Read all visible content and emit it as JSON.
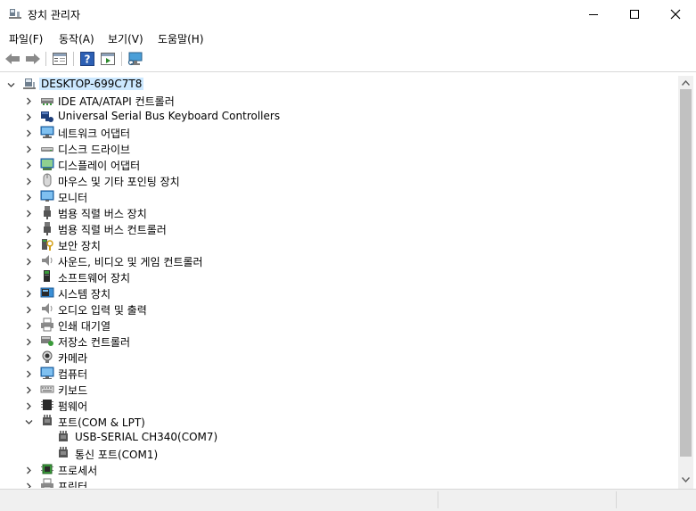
{
  "window": {
    "title": "장치 관리자"
  },
  "menu": [
    "파일(F)",
    "동작(A)",
    "보기(V)",
    "도움말(H)"
  ],
  "toolbar": [
    "back-icon",
    "forward-icon",
    "properties-icon",
    "help-icon",
    "update-driver-icon",
    "scan-hardware-icon"
  ],
  "tree": {
    "root": "DESKTOP-699C7T8",
    "categories": [
      {
        "label": "IDE ATA/ATAPI 컨트롤러",
        "icon": "ide-controller-icon",
        "expanded": false
      },
      {
        "label": "Universal Serial Bus Keyboard Controllers",
        "icon": "usb-keyboard-controller-icon",
        "expanded": false
      },
      {
        "label": "네트워크 어댑터",
        "icon": "network-adapter-icon",
        "expanded": false
      },
      {
        "label": "디스크 드라이브",
        "icon": "disk-drive-icon",
        "expanded": false
      },
      {
        "label": "디스플레이 어댑터",
        "icon": "display-adapter-icon",
        "expanded": false
      },
      {
        "label": "마우스 및 기타 포인팅 장치",
        "icon": "mouse-icon",
        "expanded": false
      },
      {
        "label": "모니터",
        "icon": "monitor-icon",
        "expanded": false
      },
      {
        "label": "범용 직렬 버스 장치",
        "icon": "usb-device-icon",
        "expanded": false
      },
      {
        "label": "범용 직렬 버스 컨트롤러",
        "icon": "usb-controller-icon",
        "expanded": false
      },
      {
        "label": "보안 장치",
        "icon": "security-device-icon",
        "expanded": false
      },
      {
        "label": "사운드, 비디오 및 게임 컨트롤러",
        "icon": "sound-icon",
        "expanded": false
      },
      {
        "label": "소프트웨어 장치",
        "icon": "software-device-icon",
        "expanded": false
      },
      {
        "label": "시스템 장치",
        "icon": "system-device-icon",
        "expanded": false
      },
      {
        "label": "오디오 입력 및 출력",
        "icon": "audio-icon",
        "expanded": false
      },
      {
        "label": "인쇄 대기열",
        "icon": "printer-queue-icon",
        "expanded": false
      },
      {
        "label": "저장소 컨트롤러",
        "icon": "storage-controller-icon",
        "expanded": false
      },
      {
        "label": "카메라",
        "icon": "camera-icon",
        "expanded": false
      },
      {
        "label": "컴퓨터",
        "icon": "computer-icon",
        "expanded": false
      },
      {
        "label": "키보드",
        "icon": "keyboard-icon",
        "expanded": false
      },
      {
        "label": "펌웨어",
        "icon": "firmware-icon",
        "expanded": false
      },
      {
        "label": "포트(COM & LPT)",
        "icon": "port-icon",
        "expanded": true,
        "children": [
          {
            "label": "USB-SERIAL CH340(COM7)",
            "icon": "port-icon"
          },
          {
            "label": "통신 포트(COM1)",
            "icon": "port-icon"
          }
        ]
      },
      {
        "label": "프로세서",
        "icon": "processor-icon",
        "expanded": false
      },
      {
        "label": "프린터",
        "icon": "printer-icon",
        "expanded": false
      }
    ]
  }
}
